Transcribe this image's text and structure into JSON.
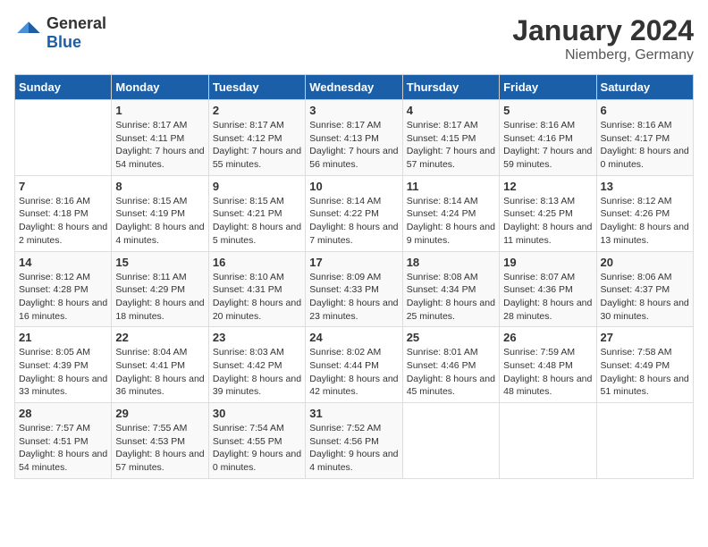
{
  "header": {
    "logo_general": "General",
    "logo_blue": "Blue",
    "month": "January 2024",
    "location": "Niemberg, Germany"
  },
  "days_of_week": [
    "Sunday",
    "Monday",
    "Tuesday",
    "Wednesday",
    "Thursday",
    "Friday",
    "Saturday"
  ],
  "weeks": [
    [
      {
        "day": "",
        "sunrise": "",
        "sunset": "",
        "daylight": ""
      },
      {
        "day": "1",
        "sunrise": "Sunrise: 8:17 AM",
        "sunset": "Sunset: 4:11 PM",
        "daylight": "Daylight: 7 hours and 54 minutes."
      },
      {
        "day": "2",
        "sunrise": "Sunrise: 8:17 AM",
        "sunset": "Sunset: 4:12 PM",
        "daylight": "Daylight: 7 hours and 55 minutes."
      },
      {
        "day": "3",
        "sunrise": "Sunrise: 8:17 AM",
        "sunset": "Sunset: 4:13 PM",
        "daylight": "Daylight: 7 hours and 56 minutes."
      },
      {
        "day": "4",
        "sunrise": "Sunrise: 8:17 AM",
        "sunset": "Sunset: 4:15 PM",
        "daylight": "Daylight: 7 hours and 57 minutes."
      },
      {
        "day": "5",
        "sunrise": "Sunrise: 8:16 AM",
        "sunset": "Sunset: 4:16 PM",
        "daylight": "Daylight: 7 hours and 59 minutes."
      },
      {
        "day": "6",
        "sunrise": "Sunrise: 8:16 AM",
        "sunset": "Sunset: 4:17 PM",
        "daylight": "Daylight: 8 hours and 0 minutes."
      }
    ],
    [
      {
        "day": "7",
        "sunrise": "Sunrise: 8:16 AM",
        "sunset": "Sunset: 4:18 PM",
        "daylight": "Daylight: 8 hours and 2 minutes."
      },
      {
        "day": "8",
        "sunrise": "Sunrise: 8:15 AM",
        "sunset": "Sunset: 4:19 PM",
        "daylight": "Daylight: 8 hours and 4 minutes."
      },
      {
        "day": "9",
        "sunrise": "Sunrise: 8:15 AM",
        "sunset": "Sunset: 4:21 PM",
        "daylight": "Daylight: 8 hours and 5 minutes."
      },
      {
        "day": "10",
        "sunrise": "Sunrise: 8:14 AM",
        "sunset": "Sunset: 4:22 PM",
        "daylight": "Daylight: 8 hours and 7 minutes."
      },
      {
        "day": "11",
        "sunrise": "Sunrise: 8:14 AM",
        "sunset": "Sunset: 4:24 PM",
        "daylight": "Daylight: 8 hours and 9 minutes."
      },
      {
        "day": "12",
        "sunrise": "Sunrise: 8:13 AM",
        "sunset": "Sunset: 4:25 PM",
        "daylight": "Daylight: 8 hours and 11 minutes."
      },
      {
        "day": "13",
        "sunrise": "Sunrise: 8:12 AM",
        "sunset": "Sunset: 4:26 PM",
        "daylight": "Daylight: 8 hours and 13 minutes."
      }
    ],
    [
      {
        "day": "14",
        "sunrise": "Sunrise: 8:12 AM",
        "sunset": "Sunset: 4:28 PM",
        "daylight": "Daylight: 8 hours and 16 minutes."
      },
      {
        "day": "15",
        "sunrise": "Sunrise: 8:11 AM",
        "sunset": "Sunset: 4:29 PM",
        "daylight": "Daylight: 8 hours and 18 minutes."
      },
      {
        "day": "16",
        "sunrise": "Sunrise: 8:10 AM",
        "sunset": "Sunset: 4:31 PM",
        "daylight": "Daylight: 8 hours and 20 minutes."
      },
      {
        "day": "17",
        "sunrise": "Sunrise: 8:09 AM",
        "sunset": "Sunset: 4:33 PM",
        "daylight": "Daylight: 8 hours and 23 minutes."
      },
      {
        "day": "18",
        "sunrise": "Sunrise: 8:08 AM",
        "sunset": "Sunset: 4:34 PM",
        "daylight": "Daylight: 8 hours and 25 minutes."
      },
      {
        "day": "19",
        "sunrise": "Sunrise: 8:07 AM",
        "sunset": "Sunset: 4:36 PM",
        "daylight": "Daylight: 8 hours and 28 minutes."
      },
      {
        "day": "20",
        "sunrise": "Sunrise: 8:06 AM",
        "sunset": "Sunset: 4:37 PM",
        "daylight": "Daylight: 8 hours and 30 minutes."
      }
    ],
    [
      {
        "day": "21",
        "sunrise": "Sunrise: 8:05 AM",
        "sunset": "Sunset: 4:39 PM",
        "daylight": "Daylight: 8 hours and 33 minutes."
      },
      {
        "day": "22",
        "sunrise": "Sunrise: 8:04 AM",
        "sunset": "Sunset: 4:41 PM",
        "daylight": "Daylight: 8 hours and 36 minutes."
      },
      {
        "day": "23",
        "sunrise": "Sunrise: 8:03 AM",
        "sunset": "Sunset: 4:42 PM",
        "daylight": "Daylight: 8 hours and 39 minutes."
      },
      {
        "day": "24",
        "sunrise": "Sunrise: 8:02 AM",
        "sunset": "Sunset: 4:44 PM",
        "daylight": "Daylight: 8 hours and 42 minutes."
      },
      {
        "day": "25",
        "sunrise": "Sunrise: 8:01 AM",
        "sunset": "Sunset: 4:46 PM",
        "daylight": "Daylight: 8 hours and 45 minutes."
      },
      {
        "day": "26",
        "sunrise": "Sunrise: 7:59 AM",
        "sunset": "Sunset: 4:48 PM",
        "daylight": "Daylight: 8 hours and 48 minutes."
      },
      {
        "day": "27",
        "sunrise": "Sunrise: 7:58 AM",
        "sunset": "Sunset: 4:49 PM",
        "daylight": "Daylight: 8 hours and 51 minutes."
      }
    ],
    [
      {
        "day": "28",
        "sunrise": "Sunrise: 7:57 AM",
        "sunset": "Sunset: 4:51 PM",
        "daylight": "Daylight: 8 hours and 54 minutes."
      },
      {
        "day": "29",
        "sunrise": "Sunrise: 7:55 AM",
        "sunset": "Sunset: 4:53 PM",
        "daylight": "Daylight: 8 hours and 57 minutes."
      },
      {
        "day": "30",
        "sunrise": "Sunrise: 7:54 AM",
        "sunset": "Sunset: 4:55 PM",
        "daylight": "Daylight: 9 hours and 0 minutes."
      },
      {
        "day": "31",
        "sunrise": "Sunrise: 7:52 AM",
        "sunset": "Sunset: 4:56 PM",
        "daylight": "Daylight: 9 hours and 4 minutes."
      },
      {
        "day": "",
        "sunrise": "",
        "sunset": "",
        "daylight": ""
      },
      {
        "day": "",
        "sunrise": "",
        "sunset": "",
        "daylight": ""
      },
      {
        "day": "",
        "sunrise": "",
        "sunset": "",
        "daylight": ""
      }
    ]
  ]
}
